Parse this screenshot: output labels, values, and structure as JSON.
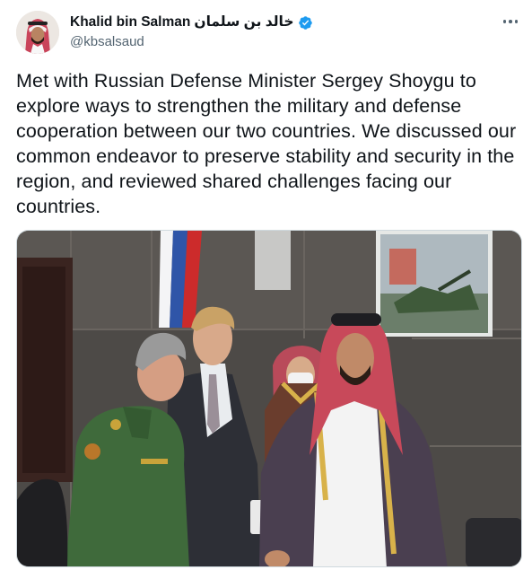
{
  "tweet": {
    "display_name": "Khalid bin Salman",
    "display_name_arabic": "خالد بن سلمان",
    "handle": "@kbsalsaud",
    "text": "Met with Russian Defense Minister Sergey Shoygu to explore ways to strengthen the military and defense cooperation between our two countries. We discussed our common endeavor to preserve stability and security in the region, and reviewed shared challenges facing our countries.",
    "icons": {
      "verified": "verified-badge-icon",
      "more": "more-options-icon"
    },
    "colors": {
      "verified": "#1d9bf0",
      "text": "#0f1419",
      "secondary": "#536471"
    }
  }
}
